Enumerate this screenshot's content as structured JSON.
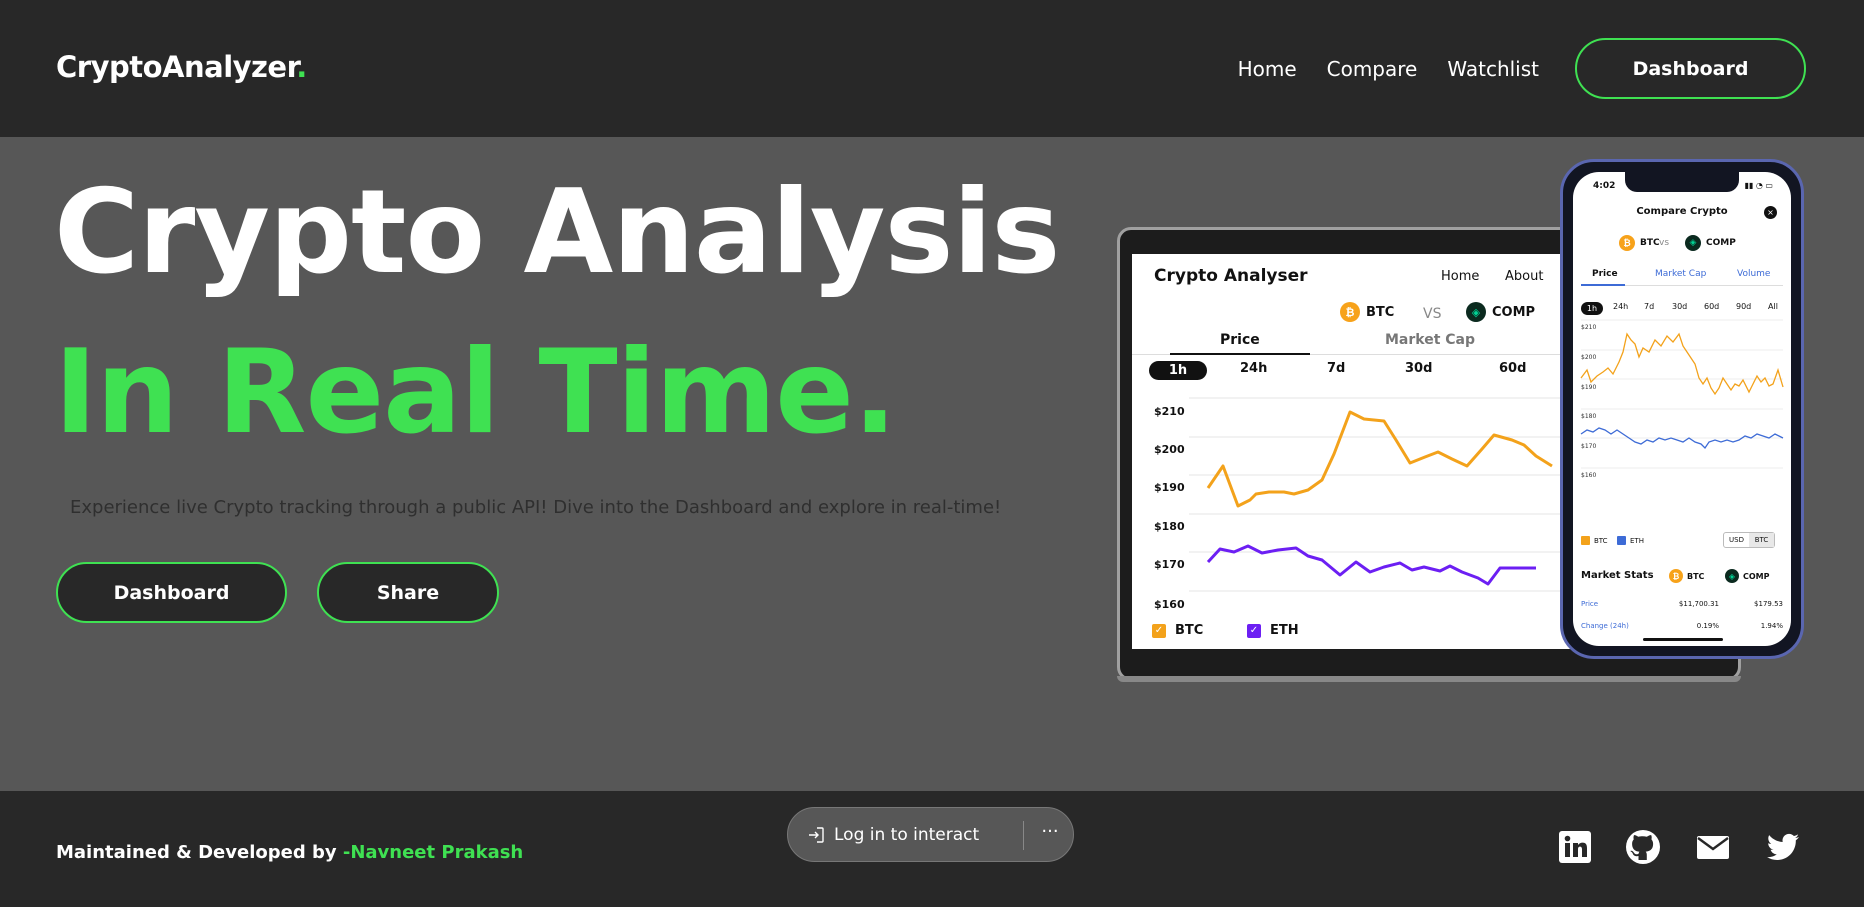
{
  "header": {
    "brand": "CryptoAnalyzer",
    "brand_dot": ".",
    "nav": [
      "Home",
      "Compare",
      "Watchlist"
    ],
    "cta": "Dashboard",
    "accent_color": "#3fe152"
  },
  "hero": {
    "line1": "Crypto Analysis",
    "line2": "In Real Time.",
    "subtitle": "Experience live Crypto tracking through a public API! Dive into the Dashboard and explore in real-time!",
    "buttons": {
      "dashboard": "Dashboard",
      "share": "Share"
    }
  },
  "laptop_mockup": {
    "title": "Crypto Analyser",
    "nav": [
      "Home",
      "About"
    ],
    "coin_a": "BTC",
    "vs": "VS",
    "coin_b": "COMP",
    "tabs": [
      "Price",
      "Market Cap"
    ],
    "timeframes": [
      "1h",
      "24h",
      "7d",
      "30d",
      "60d"
    ],
    "y_labels": [
      "$210",
      "$200",
      "$190",
      "$180",
      "$170",
      "$160"
    ],
    "legend": [
      "BTC",
      "ETH"
    ]
  },
  "phone_mockup": {
    "time": "4:02",
    "title": "Compare Crypto",
    "coin_a": "BTC",
    "vs": "vs",
    "coin_b": "COMP",
    "tabs": [
      "Price",
      "Market Cap",
      "Volume"
    ],
    "timeframes": [
      "1h",
      "24h",
      "7d",
      "30d",
      "60d",
      "90d",
      "All"
    ],
    "y_labels": [
      "$210",
      "$200",
      "$190",
      "$180",
      "$170",
      "$160"
    ],
    "legend": [
      "BTC",
      "ETH"
    ],
    "currency_toggle": [
      "USD",
      "BTC"
    ],
    "market_stats": {
      "title": "Market Stats",
      "rows": [
        {
          "label": "Price",
          "btc": "$11,700.31",
          "comp": "$179.53"
        },
        {
          "label": "Change (24h)",
          "btc": "0.19%",
          "comp": "1.94%"
        }
      ]
    }
  },
  "footer": {
    "credit_prefix": "Maintained & Developed by ",
    "credit_name": "-Navneet Prakash",
    "social_icons": [
      "linkedin-icon",
      "github-icon",
      "mail-icon",
      "twitter-icon"
    ]
  },
  "overlay": {
    "login": "Log in to interact",
    "more": "···"
  }
}
